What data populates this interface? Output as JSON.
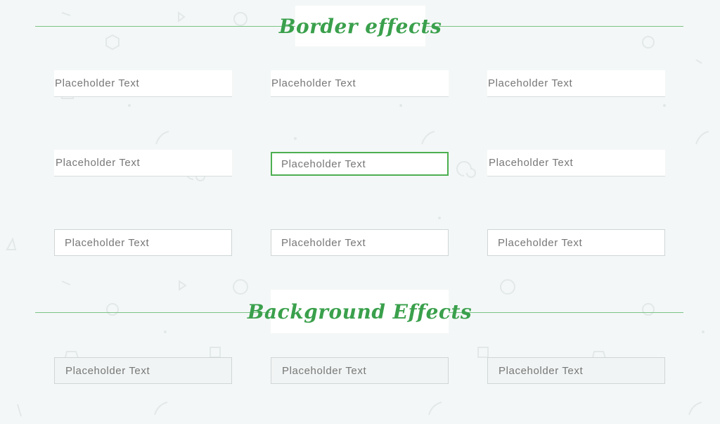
{
  "sections": {
    "border": {
      "title": "Border effects"
    },
    "background": {
      "title": "Background Effects"
    }
  },
  "fields": {
    "border_row1": [
      "Placeholder Text",
      "Placeholder Text",
      "Placeholder Text"
    ],
    "border_row2": [
      "Placeholder Text",
      "Placeholder Text",
      "Placeholder Text"
    ],
    "border_row3": [
      "Placeholder Text",
      "Placeholder Text",
      "Placeholder Text"
    ],
    "background_row1": [
      "Placeholder Text",
      "Placeholder Text",
      "Placeholder Text"
    ]
  },
  "colors": {
    "accent": "#3aa04c",
    "rule": "#7cc487",
    "page_bg": "#f4f7f7",
    "placeholder_text": "#777777"
  }
}
